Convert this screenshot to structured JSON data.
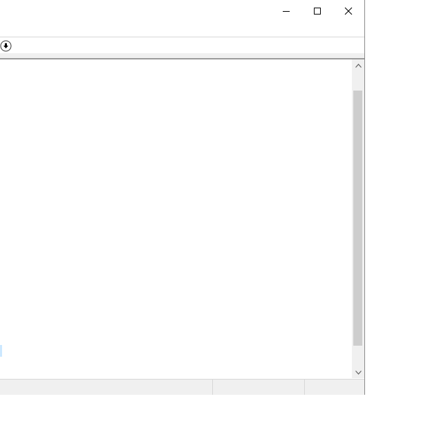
{
  "window": {
    "title": "",
    "controls": {
      "minimize": "minimize-icon",
      "maximize": "maximize-icon",
      "close": "close-icon"
    }
  },
  "toolbar": {
    "download_icon": "download-arrow-icon"
  },
  "content": {
    "text": ""
  },
  "scrollbar": {
    "up_icon": "chevron-up-icon",
    "down_icon": "chevron-down-icon",
    "thumb_position": 0.0
  },
  "statusbar": {
    "pane1": "",
    "pane2": "",
    "pane3": ""
  },
  "colors": {
    "chrome": "#f0f0f0",
    "thumb": "#cdcdcd",
    "selection": "#cce8ff"
  }
}
